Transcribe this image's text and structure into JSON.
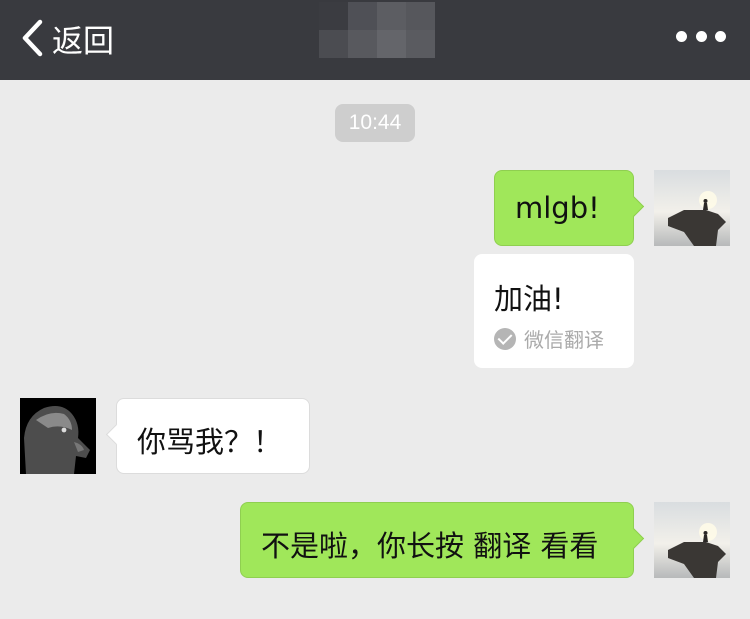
{
  "header": {
    "back_label": "返回",
    "back_icon": "chevron-left-icon",
    "more_icon": "more-dots-icon",
    "title_mosaic_colors": [
      "#3b3c41",
      "#4f5056",
      "#5c5d62",
      "#56575c",
      "#4b4c51",
      "#58595e",
      "#64656a",
      "#5a5b60"
    ]
  },
  "chat": {
    "timestamp": "10:44",
    "messages": [
      {
        "sender": "me",
        "text": "mlgb!"
      },
      {
        "translation": "加油!",
        "badge": "微信翻译"
      },
      {
        "sender": "friend",
        "text": "你骂我？！"
      },
      {
        "sender": "me",
        "text": "不是啦，你长按 翻译 看看"
      }
    ]
  },
  "colors": {
    "topbar": "#393a3f",
    "background": "#ebebeb",
    "my_bubble": "#a0e75a",
    "friend_bubble": "#ffffff",
    "timestamp_bg": "#cecece"
  }
}
